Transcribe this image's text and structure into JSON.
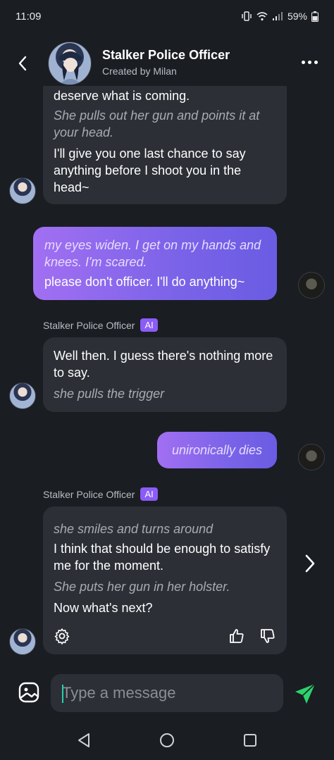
{
  "status": {
    "time": "11:09",
    "battery": "59%"
  },
  "header": {
    "title": "Stalker Police Officer",
    "subtitle": "Created by Milan"
  },
  "messages": {
    "m1": {
      "cut_text": "deserve what is coming.",
      "action": "She pulls out her gun and points it at your head.",
      "speech": "I'll give you one last chance to say anything before I shoot you in the head~"
    },
    "m2": {
      "action": "my eyes widen. I get on my hands and knees. I'm scared.",
      "speech": "please don't officer. I'll do anything~"
    },
    "m3": {
      "name": "Stalker Police Officer",
      "badge": "AI",
      "speech": "Well then. I guess there's nothing more to say.",
      "action": "she pulls the trigger"
    },
    "m4": {
      "action": "unironically dies"
    },
    "m5": {
      "name": "Stalker Police Officer",
      "badge": "AI",
      "action1": "she smiles and turns around",
      "speech1": "I think that should be enough to satisfy me for the moment.",
      "action2": "She puts her gun in her holster.",
      "speech2": "Now what's next?"
    }
  },
  "composer": {
    "placeholder": "Type a message"
  },
  "colors": {
    "background": "#1a1d22",
    "bubble_ai": "#2c2f36",
    "bubble_user_start": "#a26ff2",
    "bubble_user_end": "#6a5ce3",
    "accent_badge": "#8b5cf6",
    "send": "#2bd36b"
  },
  "icons": {
    "back": "chevron-left-icon",
    "more": "more-horizontal-icon",
    "settings": "gear-icon",
    "like": "thumbs-up-icon",
    "dislike": "thumbs-down-icon",
    "next": "chevron-right-icon",
    "image": "image-icon",
    "send": "send-icon"
  }
}
